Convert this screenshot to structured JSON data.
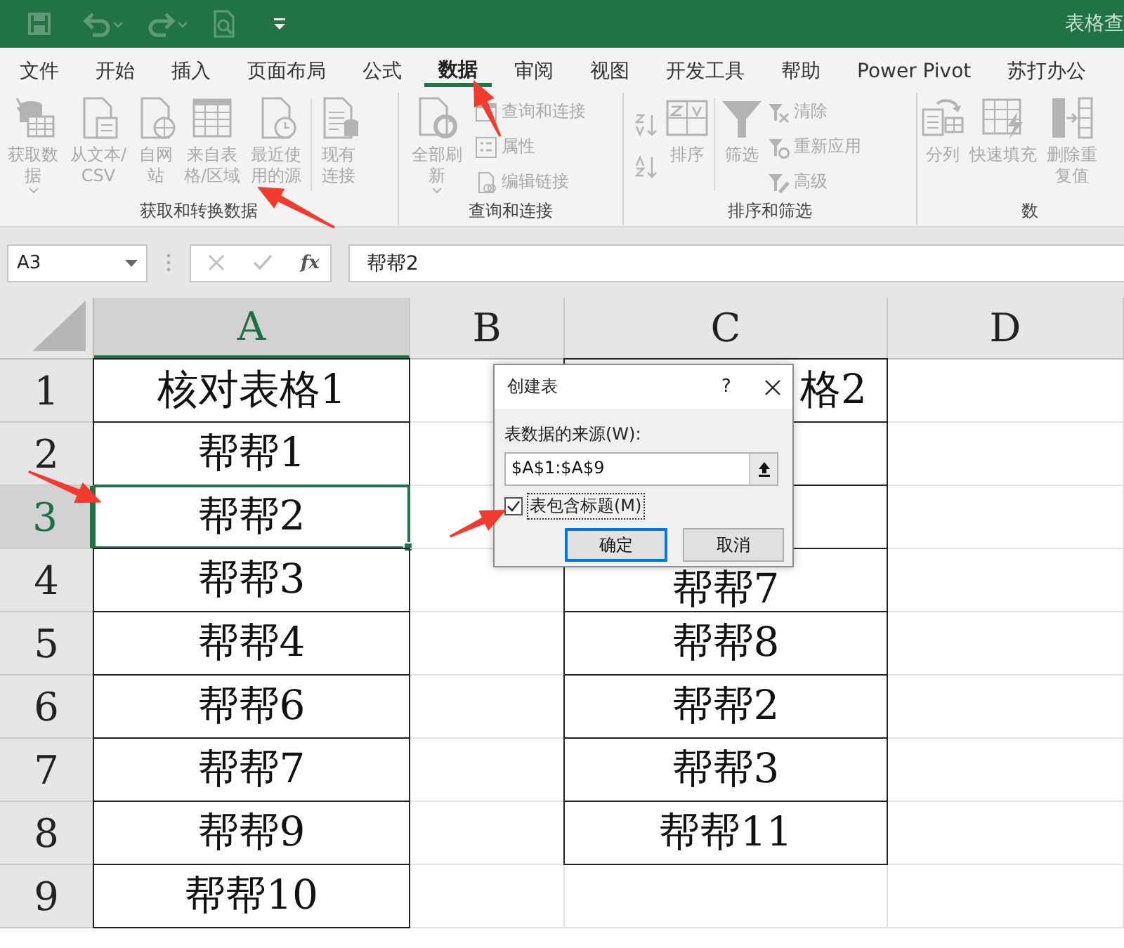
{
  "window": {
    "title": "表格查"
  },
  "tabs": [
    {
      "label": "文件",
      "selected": false
    },
    {
      "label": "开始",
      "selected": false
    },
    {
      "label": "插入",
      "selected": false
    },
    {
      "label": "页面布局",
      "selected": false
    },
    {
      "label": "公式",
      "selected": false
    },
    {
      "label": "数据",
      "selected": true
    },
    {
      "label": "审阅",
      "selected": false
    },
    {
      "label": "视图",
      "selected": false
    },
    {
      "label": "开发工具",
      "selected": false
    },
    {
      "label": "帮助",
      "selected": false
    },
    {
      "label": "Power Pivot",
      "selected": false
    },
    {
      "label": "苏打办公",
      "selected": false
    }
  ],
  "ribbon": {
    "disabled": true,
    "groups": [
      {
        "label": "获取和转换数据",
        "items": [
          {
            "kind": "large",
            "label": "获取数据",
            "dropdown": true
          },
          {
            "kind": "large",
            "label": "从文本/CSV",
            "dropdown": false
          },
          {
            "kind": "large",
            "label": "自网站",
            "dropdown": false
          },
          {
            "kind": "large",
            "label": "来自表格/区域",
            "dropdown": false
          },
          {
            "kind": "large",
            "label": "最近使用的源",
            "dropdown": false
          },
          {
            "kind": "separator"
          },
          {
            "kind": "large",
            "label": "现有连接",
            "dropdown": false
          }
        ]
      },
      {
        "label": "查询和连接",
        "items": [
          {
            "kind": "large",
            "label": "全部刷新",
            "dropdown": true
          },
          {
            "kind": "stack",
            "items": [
              {
                "label": "查询和连接"
              },
              {
                "label": "属性"
              },
              {
                "label": "编辑链接"
              }
            ]
          }
        ]
      },
      {
        "label": "排序和筛选",
        "items": [
          {
            "kind": "sort-pair"
          },
          {
            "kind": "large",
            "label": "排序",
            "dropdown": false
          },
          {
            "kind": "separator"
          },
          {
            "kind": "large",
            "label": "筛选",
            "dropdown": false
          },
          {
            "kind": "stack",
            "items": [
              {
                "label": "清除"
              },
              {
                "label": "重新应用"
              },
              {
                "label": "高级"
              }
            ]
          }
        ]
      },
      {
        "label": "数",
        "items": [
          {
            "kind": "large",
            "label": "分列",
            "dropdown": false
          },
          {
            "kind": "large",
            "label": "快速填充",
            "dropdown": false
          },
          {
            "kind": "large",
            "label": "删除重复值",
            "dropdown": false
          }
        ]
      }
    ]
  },
  "formula_bar": {
    "name_box": "A3",
    "function_label": "fx",
    "formula": "帮帮2"
  },
  "sheet": {
    "columns": [
      {
        "label": "A",
        "selected": true
      },
      {
        "label": "B",
        "selected": false
      },
      {
        "label": "C",
        "selected": false
      },
      {
        "label": "D",
        "selected": false
      }
    ],
    "rows": [
      {
        "label": "1",
        "selected": false,
        "cells": [
          {
            "text": "核对表格1",
            "bordered": true,
            "selected": false
          },
          {
            "bordered": false,
            "selected": false
          },
          {
            "text": "格2",
            "bordered": true,
            "selected": false,
            "clipped": true
          },
          {
            "bordered": false,
            "selected": false
          }
        ]
      },
      {
        "label": "2",
        "selected": false,
        "cells": [
          {
            "text": "帮帮1",
            "bordered": true,
            "selected": false
          },
          {
            "bordered": false,
            "selected": false
          },
          {
            "bordered": true,
            "selected": false
          },
          {
            "bordered": false,
            "selected": false
          }
        ]
      },
      {
        "label": "3",
        "selected": true,
        "cells": [
          {
            "text": "帮帮2",
            "bordered": true,
            "selected": true
          },
          {
            "bordered": false,
            "selected": false
          },
          {
            "bordered": true,
            "selected": false
          },
          {
            "bordered": false,
            "selected": false
          }
        ]
      },
      {
        "label": "4",
        "selected": false,
        "cells": [
          {
            "text": "帮帮3",
            "bordered": true,
            "selected": false
          },
          {
            "bordered": false,
            "selected": false
          },
          {
            "text": "帮帮7",
            "bordered": true,
            "selected": false,
            "clipped": true
          },
          {
            "bordered": false,
            "selected": false
          }
        ]
      },
      {
        "label": "5",
        "selected": false,
        "cells": [
          {
            "text": "帮帮4",
            "bordered": true,
            "selected": false
          },
          {
            "bordered": false,
            "selected": false
          },
          {
            "text": "帮帮8",
            "bordered": true,
            "selected": false
          },
          {
            "bordered": false,
            "selected": false
          }
        ]
      },
      {
        "label": "6",
        "selected": false,
        "cells": [
          {
            "text": "帮帮6",
            "bordered": true,
            "selected": false
          },
          {
            "bordered": false,
            "selected": false
          },
          {
            "text": "帮帮2",
            "bordered": true,
            "selected": false
          },
          {
            "bordered": false,
            "selected": false
          }
        ]
      },
      {
        "label": "7",
        "selected": false,
        "cells": [
          {
            "text": "帮帮7",
            "bordered": true,
            "selected": false
          },
          {
            "bordered": false,
            "selected": false
          },
          {
            "text": "帮帮3",
            "bordered": true,
            "selected": false
          },
          {
            "bordered": false,
            "selected": false
          }
        ]
      },
      {
        "label": "8",
        "selected": false,
        "cells": [
          {
            "text": "帮帮9",
            "bordered": true,
            "selected": false
          },
          {
            "bordered": false,
            "selected": false
          },
          {
            "text": "帮帮11",
            "bordered": true,
            "selected": false
          },
          {
            "bordered": false,
            "selected": false
          }
        ]
      },
      {
        "label": "9",
        "selected": false,
        "cells": [
          {
            "text": "帮帮10",
            "bordered": true,
            "selected": false
          },
          {
            "bordered": false,
            "selected": false
          },
          {
            "bordered": false,
            "selected": false
          },
          {
            "bordered": false,
            "selected": false
          }
        ]
      }
    ]
  },
  "dialog": {
    "title": "创建表",
    "help": "?",
    "source_label": "表数据的来源(W):",
    "source_value": "$A$1:$A$9",
    "has_headers": {
      "label": "表包含标题(M)",
      "checked": true
    },
    "buttons": [
      {
        "label": "确定",
        "default": true
      },
      {
        "label": "取消",
        "default": false
      }
    ]
  }
}
